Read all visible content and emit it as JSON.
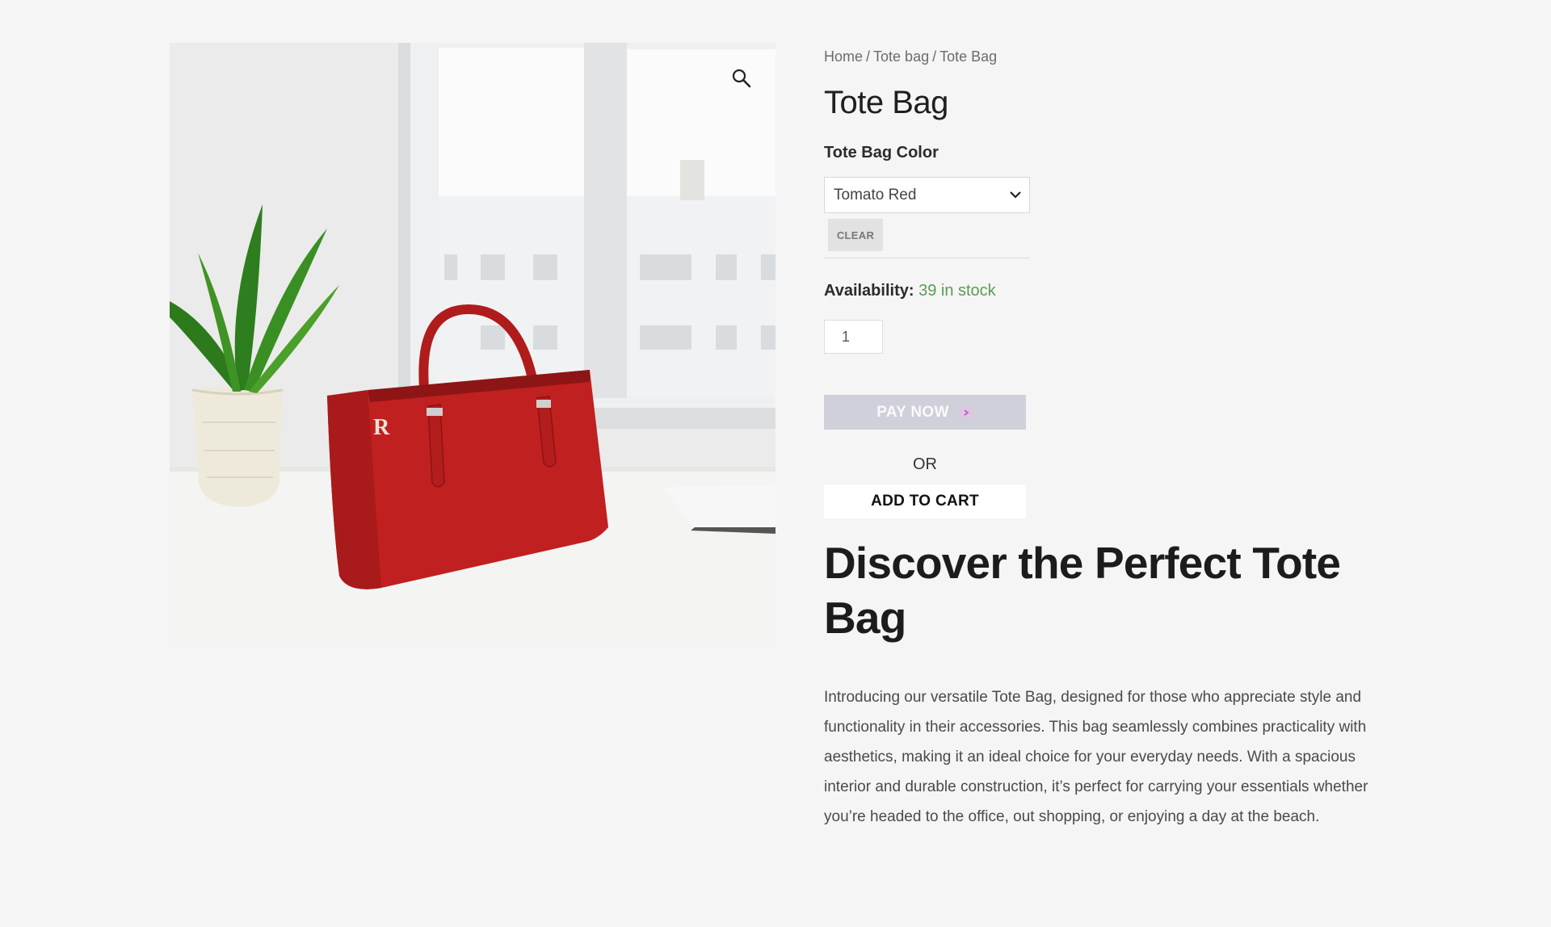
{
  "breadcrumb": {
    "items": [
      "Home",
      "Tote bag",
      "Tote Bag"
    ],
    "separator": "/"
  },
  "product": {
    "title": "Tote Bag",
    "image_alt_icon": "zoom-magnifier-icon"
  },
  "variation": {
    "label": "Tote Bag Color",
    "selected": "Tomato Red",
    "clear_label": "CLEAR"
  },
  "availability": {
    "label": "Availability:",
    "value": "39 in stock"
  },
  "quantity": {
    "value": "1"
  },
  "buttons": {
    "pay_now": "PAY NOW",
    "or": "OR",
    "add_to_cart": "ADD TO CART"
  },
  "content": {
    "headline": "Discover the Perfect Tote Bag",
    "description": "Introducing our versatile Tote Bag, designed for those who appreciate style and functionality in their accessories. This bag seamlessly combines practicality with aesthetics, making it an ideal choice for your everyday needs. With a spacious interior and durable construction, it’s perfect for carrying your essentials whether you’re headed to the office, out shopping, or enjoying a day at the beach."
  },
  "colors": {
    "accent_stock": "#5b9c54",
    "pay_now_bg": "#cfd0da",
    "bag_red": "#c0201f",
    "page_bg": "#f5f5f5"
  },
  "image": {
    "bag_monogram": "R"
  }
}
